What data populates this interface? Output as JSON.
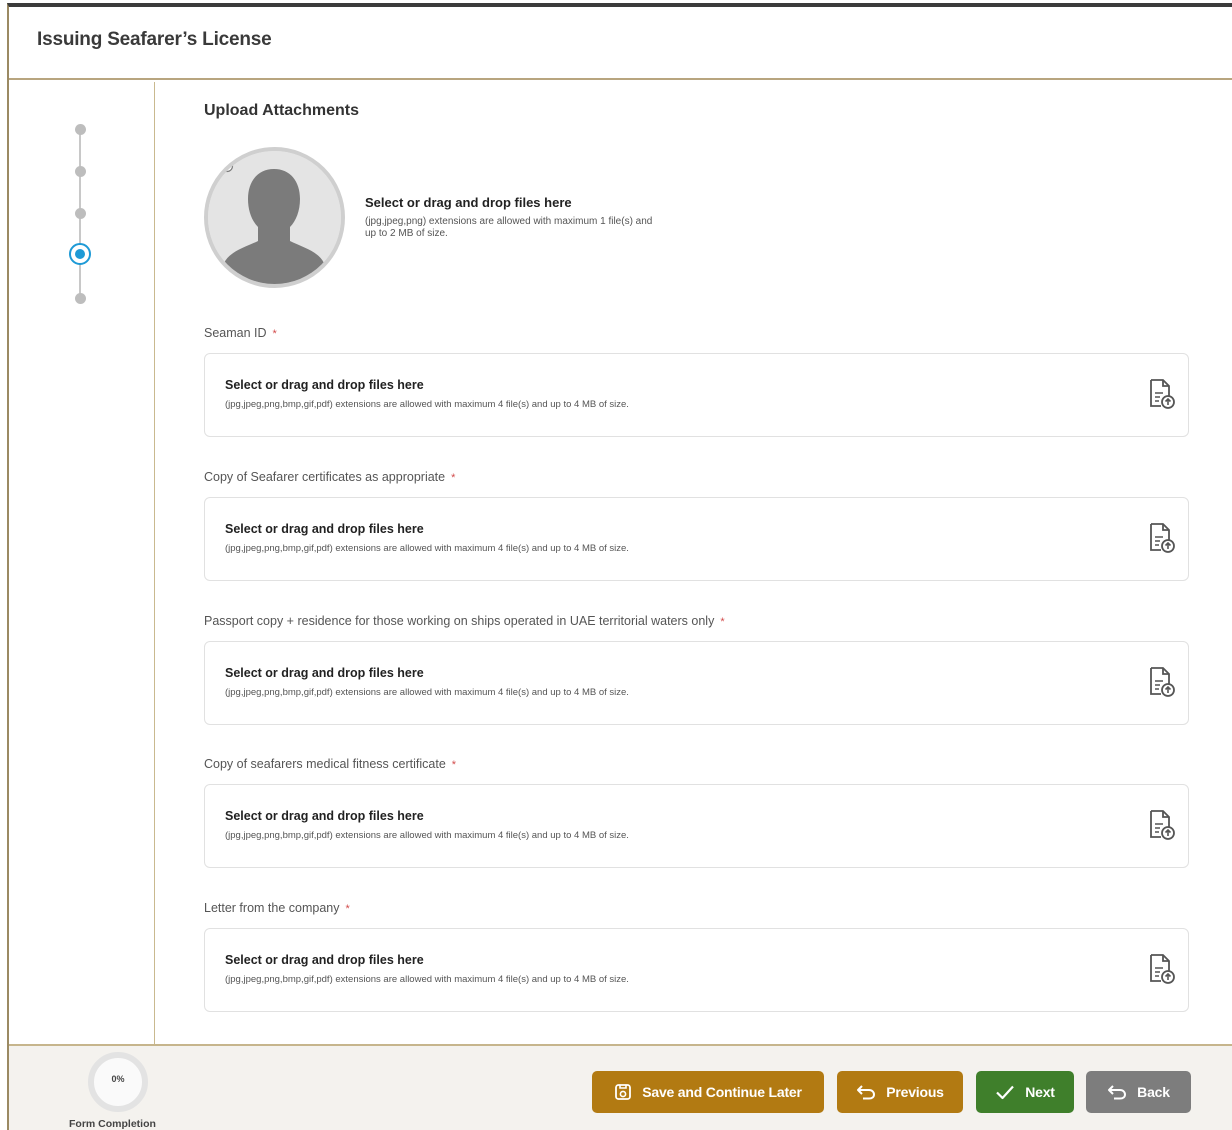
{
  "header": {
    "title": "Issuing Seafarer’s License"
  },
  "main": {
    "section_title": "Upload Attachments",
    "photo_upload": {
      "heading": "Select or drag and drop files here",
      "hint": "(jpg,jpeg,png) extensions are allowed with maximum 1 file(s) and up to 2 MB of size."
    },
    "attachments": [
      {
        "label": "Seaman ID",
        "required_mark": "*",
        "heading": "Select or drag and drop files here",
        "hint": "(jpg,jpeg,png,bmp,gif,pdf) extensions are allowed with maximum 4 file(s) and up to 4 MB of size."
      },
      {
        "label": "Copy of Seafarer certificates as appropriate",
        "required_mark": "*",
        "heading": "Select or drag and drop files here",
        "hint": "(jpg,jpeg,png,bmp,gif,pdf) extensions are allowed with maximum 4 file(s) and up to 4 MB of size."
      },
      {
        "label": "Passport copy + residence for those working on ships operated in UAE territorial waters only",
        "required_mark": "*",
        "heading": "Select or drag and drop files here",
        "hint": "(jpg,jpeg,png,bmp,gif,pdf) extensions are allowed with maximum 4 file(s) and up to 4 MB of size."
      },
      {
        "label": "Copy of seafarers medical fitness certificate",
        "required_mark": "*",
        "heading": "Select or drag and drop files here",
        "hint": "(jpg,jpeg,png,bmp,gif,pdf) extensions are allowed with maximum 4 file(s) and up to 4 MB of size."
      },
      {
        "label": "Letter from the company",
        "required_mark": "*",
        "heading": "Select or drag and drop files here",
        "hint": "(jpg,jpeg,png,bmp,gif,pdf) extensions are allowed with maximum 4 file(s) and up to 4 MB of size."
      }
    ]
  },
  "stepper": {
    "total_steps": 5,
    "active_step": 4,
    "active_color": "#1e9ad6"
  },
  "footer": {
    "completion_percent": "0%",
    "completion_label": "Form Completion",
    "buttons": {
      "save": "Save and Continue Later",
      "previous": "Previous",
      "next": "Next",
      "back": "Back"
    }
  },
  "colors": {
    "accent_gold": "#b27a12",
    "next_green": "#3f7f2b",
    "back_gray": "#7d7d7d",
    "required_red": "#d24b4b"
  },
  "icons": {
    "avatar": "user-silhouette-icon",
    "camera": "camera-add-icon",
    "upload": "file-upload-icon",
    "save": "save-icon",
    "previous": "undo-arrow-icon",
    "next": "checkmark-icon",
    "back": "back-arrow-icon"
  }
}
